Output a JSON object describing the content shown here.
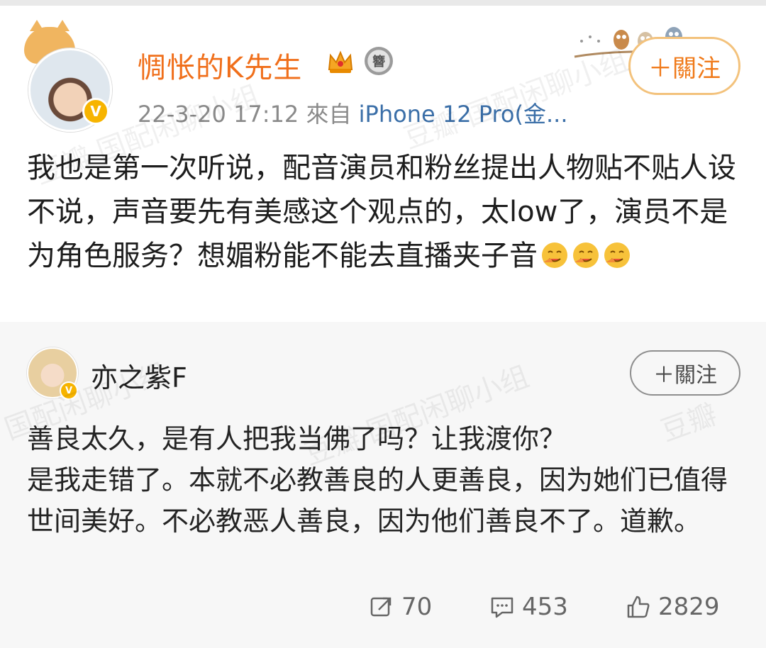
{
  "post": {
    "author_name": "惆怅的K先生",
    "badge_medal_text": "簪",
    "timestamp": "22-3-20 17:12",
    "source_prefix": "來自",
    "source_device": "iPhone 12 Pro(金...",
    "follow_label": "＋關注",
    "content": "我也是第一次听说，配音演员和粉丝提出人物贴不贴人设不说，声音要先有美感这个观点的，太low了，演员不是为角色服务？想媚粉能不能去直播夹子音"
  },
  "comment": {
    "author_name": "亦之紫F",
    "follow_label": "＋關注",
    "lines": [
      "善良太久，是有人把我当佛了吗？让我渡你？",
      "是我走错了。本就不必教善良的人更善良，因为她们已值得世间美好。不必教恶人善良，因为他们善良不了。道歉。"
    ]
  },
  "actions": {
    "repost_count": "70",
    "comment_count": "453",
    "like_count": "2829"
  },
  "watermark": {
    "text": "国配闲聊小组",
    "logo": "豆瓣"
  },
  "colors": {
    "name_orange": "#f06f1b",
    "follow_border": "#f3c27c",
    "link_blue": "#3b6fa8",
    "verified_gold": "#f7b400"
  },
  "icons": [
    "crown-icon",
    "medal-icon",
    "verified-icon",
    "repost-icon",
    "comment-icon",
    "like-icon",
    "emoji-icon",
    "owls-decoration"
  ]
}
